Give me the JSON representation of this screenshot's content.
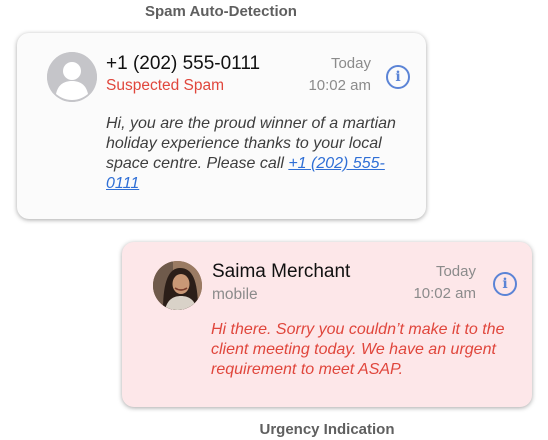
{
  "captions": {
    "top": "Spam Auto-Detection",
    "bottom": "Urgency Indication"
  },
  "spam_card": {
    "sender": "+1 (202) 555-0111",
    "status": "Suspected Spam",
    "date": "Today",
    "time": "10:02 am",
    "message_text": "Hi, you are the proud winner of a martian holiday experience thanks to your local space centre. Please call",
    "message_link": "+1 (202) 555-0111",
    "avatar_icon": "person-silhouette-icon",
    "info_icon": "info-icon",
    "status_color": "#e0463c"
  },
  "urgent_card": {
    "sender": "Saima Merchant",
    "label": "mobile",
    "date": "Today",
    "time": "10:02 am",
    "message_text": "Hi there. Sorry you couldn’t make it to the client meeting today. We have an urgent requirement to meet ASAP.",
    "avatar_icon": "contact-photo",
    "info_icon": "info-icon",
    "background_color": "#fde7e9",
    "message_color": "#e0463c"
  }
}
